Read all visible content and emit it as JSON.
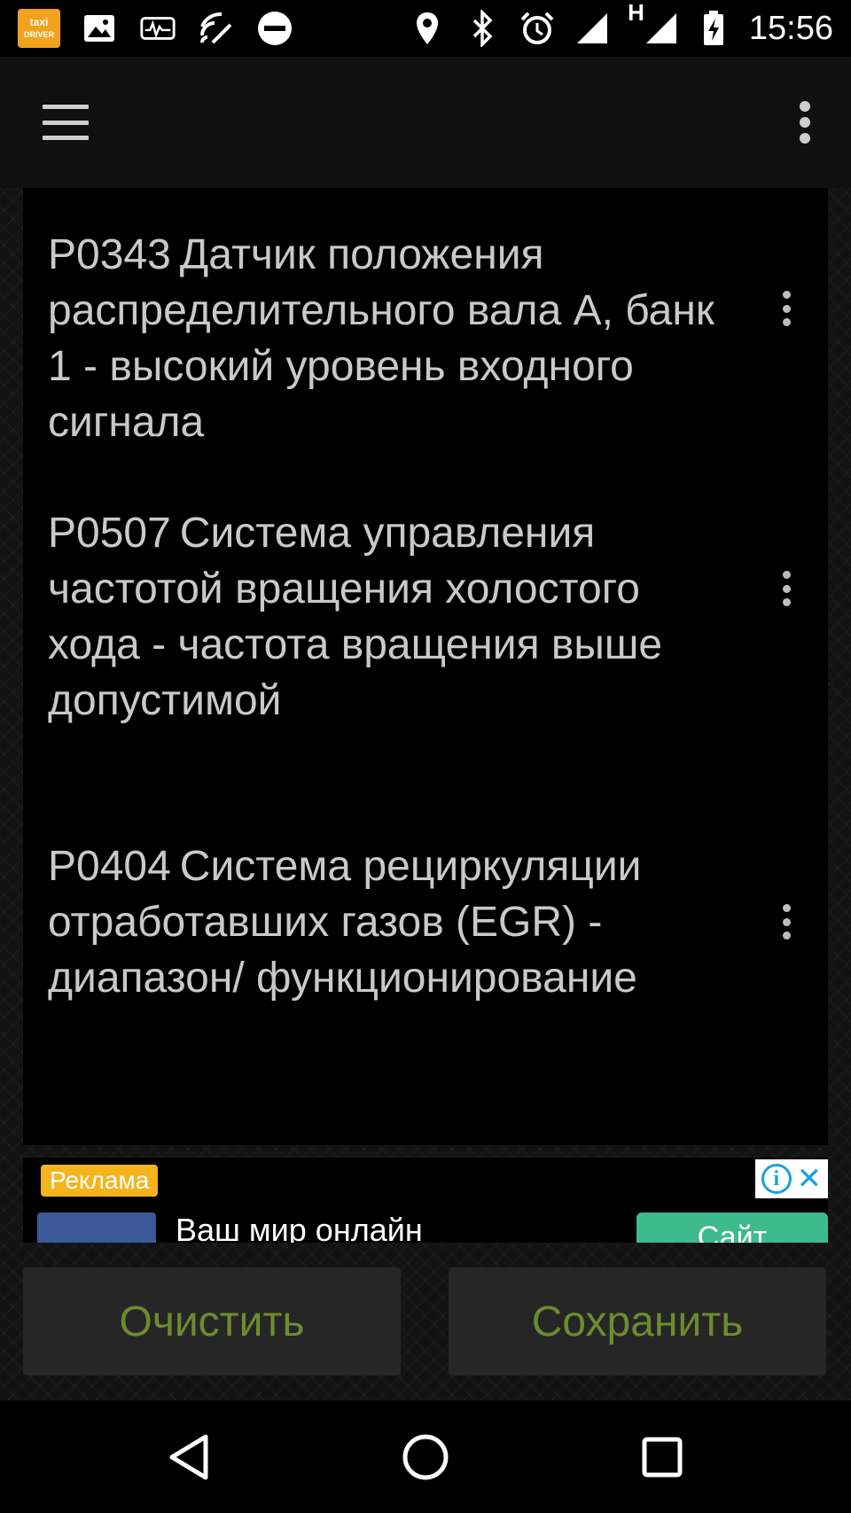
{
  "status_bar": {
    "taxi_app_label_top": "taxi",
    "taxi_app_label_bottom": "DRIVER",
    "network_type": "H",
    "time": "15:56"
  },
  "dtc_list": [
    {
      "code": "P0343",
      "description": "Датчик положения распределительного вала А, банк 1 - высокий уровень входного сигнала"
    },
    {
      "code": "P0507",
      "description": "Система управления частотой вращения холостого хода - частота вращения выше допустимой"
    },
    {
      "code": "P0404",
      "description": "Система рециркуляции отработавших газов (EGR) - диапазон/ функционирование"
    }
  ],
  "ad": {
    "label": "Реклама",
    "info_glyph": "i",
    "close_glyph": "✕",
    "title": "Ваш мир онлайн",
    "cta": "Сайт"
  },
  "buttons": {
    "clear_label": "Очистить",
    "save_label": "Сохранить"
  },
  "colors": {
    "button_text": "#6d8b2f",
    "ad_label_bg": "#f5b31d",
    "ad_cta_bg": "#3dbb8f"
  },
  "icons": [
    "taxi-driver-app-icon",
    "image-icon",
    "obd-icon",
    "cast-icon",
    "do-not-disturb-icon",
    "location-icon",
    "bluetooth-icon",
    "alarm-icon",
    "signal-icon",
    "battery-charging-icon",
    "menu-icon",
    "overflow-icon",
    "back-icon",
    "home-icon",
    "recents-icon"
  ]
}
